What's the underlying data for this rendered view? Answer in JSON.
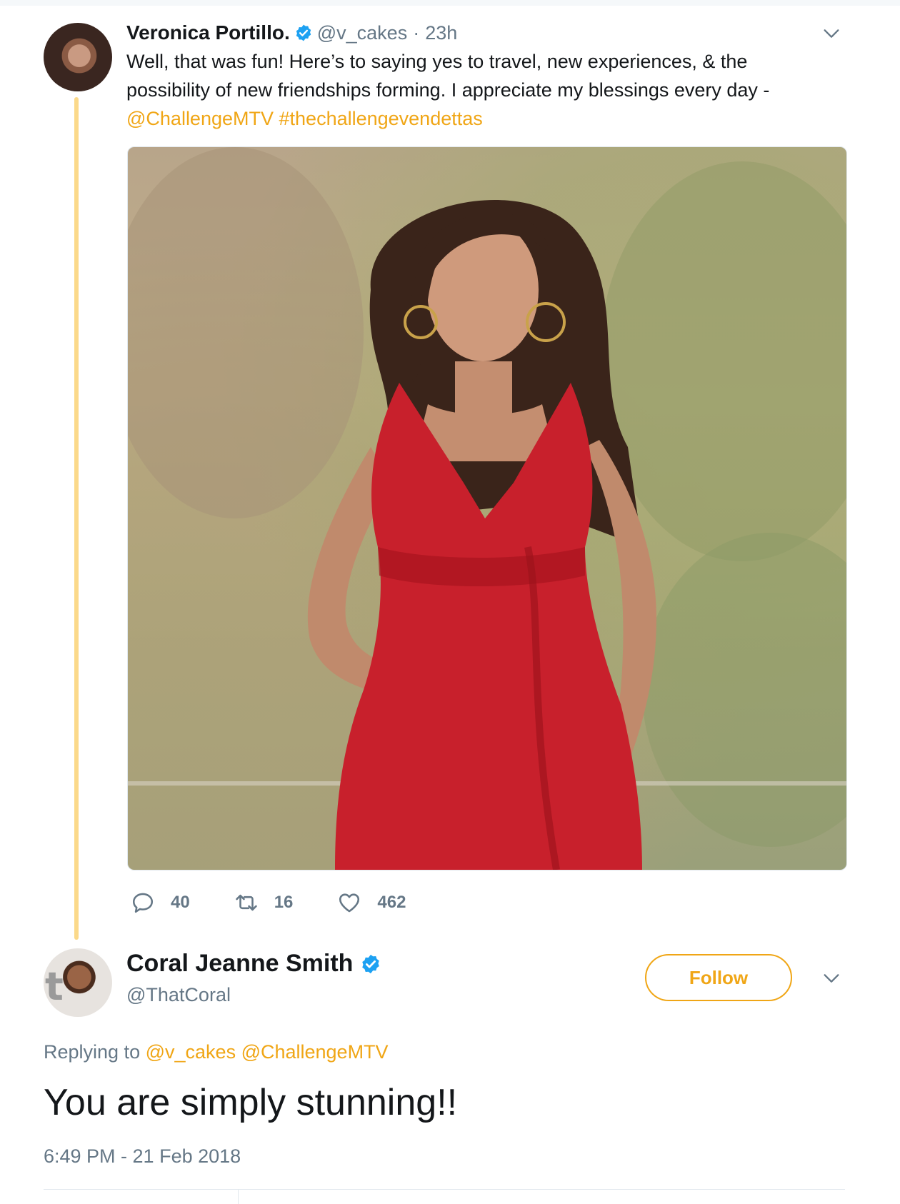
{
  "tweet": {
    "author": {
      "display_name": "Veronica Portillo.",
      "handle": "@v_cakes",
      "verified": true
    },
    "separator": "·",
    "time": "23h",
    "text_line1": "Well, that was fun!  Here’s to saying yes to travel, new experiences, & the",
    "text_line2": "possibility of new friendships forming.  I appreciate my blessings every day -",
    "mention": "@ChallengeMTV",
    "hashtag": "#thechallengevendettas",
    "stats": {
      "replies": "40",
      "retweets": "16",
      "likes": "462"
    }
  },
  "reply": {
    "author": {
      "display_name": "Coral Jeanne Smith",
      "handle": "@ThatCoral",
      "verified": true
    },
    "follow_label": "Follow",
    "replying_prefix": "Replying to",
    "replying_handles": "@v_cakes @ChallengeMTV",
    "text": "You are simply stunning!!",
    "timestamp": "6:49 PM - 21 Feb 2018"
  },
  "colors": {
    "accent": "#f0a616",
    "thread_line": "#fbd98a",
    "verified": "#1da1f2",
    "muted": "#657786"
  },
  "icons": [
    "verified-badge-icon",
    "chevron-down-icon",
    "reply-icon",
    "retweet-icon",
    "like-icon"
  ]
}
